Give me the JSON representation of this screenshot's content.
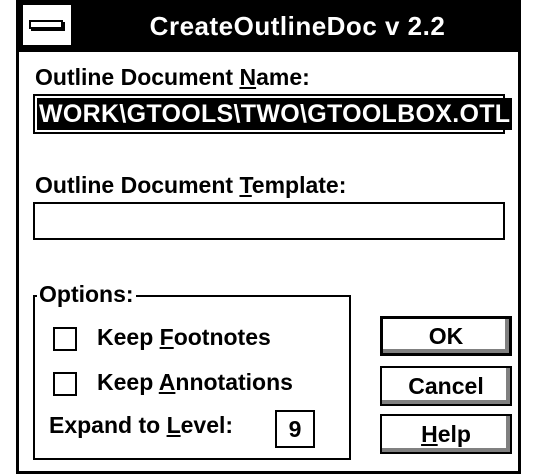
{
  "window": {
    "title": "CreateOutlineDoc v 2.2"
  },
  "name_field": {
    "label_pre": "Outline Document ",
    "label_mnemonic": "N",
    "label_post": "ame:",
    "value": "WORK\\GTOOLS\\TWO\\GTOOLBOX.OTL"
  },
  "template_field": {
    "label_pre": "Outline Document ",
    "label_mnemonic": "T",
    "label_post": "emplate:",
    "value": ""
  },
  "options": {
    "legend": "Options:",
    "keep_footnotes": {
      "label_pre": "Keep ",
      "label_mnemonic": "F",
      "label_post": "ootnotes",
      "checked": false
    },
    "keep_annotations": {
      "label_pre": "Keep ",
      "label_mnemonic": "A",
      "label_post": "nnotations",
      "checked": false
    },
    "expand_level": {
      "label_pre": "Expand to ",
      "label_mnemonic": "L",
      "label_post": "evel:",
      "value": "9"
    }
  },
  "buttons": {
    "ok": "OK",
    "cancel": "Cancel",
    "help_mnemonic": "H",
    "help_post": "elp"
  }
}
